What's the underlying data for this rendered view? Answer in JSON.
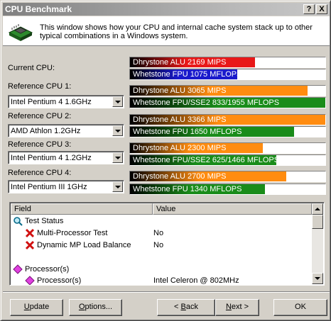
{
  "window": {
    "title": "CPU Benchmark",
    "help_glyph": "?",
    "close_glyph": "X"
  },
  "header": {
    "description": "This window shows how your CPU and internal cache system stack up to other typical combinations in a Windows system."
  },
  "current": {
    "label": "Current CPU:",
    "alu": {
      "text": "Dhrystone ALU 2169 MIPS",
      "fraction": 0.64
    },
    "fpu": {
      "text": "Whetstone FPU 1075 MFLOPS",
      "fraction": 0.55
    }
  },
  "references": [
    {
      "label": "Reference CPU 1:",
      "selected": "Intel Pentium 4 1.6GHz",
      "alu": {
        "text": "Dhrystone ALU 3065 MIPS",
        "fraction": 0.91
      },
      "fpu": {
        "text": "Whetstone FPU/SSE2 833/1955 MFLOPS",
        "fraction": 1.0
      }
    },
    {
      "label": "Reference CPU 2:",
      "selected": "AMD Athlon 1.2GHz",
      "alu": {
        "text": "Dhrystone ALU 3366 MIPS",
        "fraction": 1.0
      },
      "fpu": {
        "text": "Whetstone FPU 1650 MFLOPS",
        "fraction": 0.84
      }
    },
    {
      "label": "Reference CPU 3:",
      "selected": "Intel Pentium 4 1.2GHz",
      "alu": {
        "text": "Dhrystone ALU 2300 MIPS",
        "fraction": 0.68
      },
      "fpu": {
        "text": "Whetstone FPU/SSE2 625/1466 MFLOPS",
        "fraction": 0.75
      }
    },
    {
      "label": "Reference CPU 4:",
      "selected": "Intel Pentium III 1GHz",
      "alu": {
        "text": "Dhrystone ALU 2700 MIPS",
        "fraction": 0.8
      },
      "fpu": {
        "text": "Whetstone FPU 1340 MFLOPS",
        "fraction": 0.69
      }
    }
  ],
  "list": {
    "columns": [
      "Field",
      "Value"
    ],
    "rows": [
      {
        "indent": 0,
        "icon": "magnifier-icon",
        "field": "Test Status",
        "value": ""
      },
      {
        "indent": 1,
        "icon": "red-x-icon",
        "field": "Multi-Processor Test",
        "value": "No"
      },
      {
        "indent": 1,
        "icon": "red-x-icon",
        "field": "Dynamic MP Load Balance",
        "value": "No"
      },
      {
        "indent": 0,
        "icon": "",
        "field": "",
        "value": ""
      },
      {
        "indent": 0,
        "icon": "processor-diamond-icon",
        "field": "Processor(s)",
        "value": ""
      },
      {
        "indent": 1,
        "icon": "processor-diamond-icon",
        "field": "Processor(s)",
        "value": "Intel Celeron @ 802MHz"
      }
    ]
  },
  "buttons": {
    "update": {
      "mnemonic": "U",
      "rest": "pdate"
    },
    "options": {
      "mnemonic": "O",
      "rest": "ptions..."
    },
    "back": {
      "prefix": "< ",
      "mnemonic": "B",
      "rest": "ack"
    },
    "next": {
      "mnemonic": "N",
      "rest": "ext >"
    },
    "ok": "OK"
  },
  "colors": {
    "alu_current": "#e81818",
    "fpu_current": "#1a1acc",
    "alu_ref": "#ff8c10",
    "fpu_ref": "#1a8c1a"
  }
}
